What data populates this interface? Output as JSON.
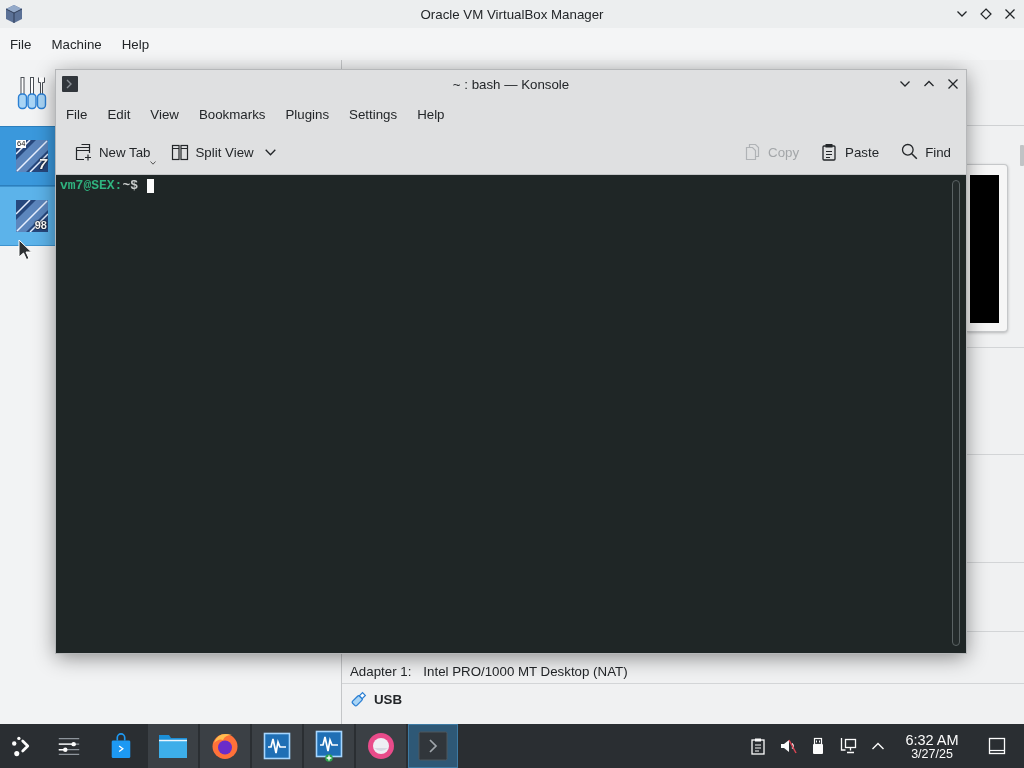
{
  "vbox_window": {
    "title": "Oracle VM VirtualBox Manager",
    "menu": [
      {
        "label": "File"
      },
      {
        "label": "Machine"
      },
      {
        "label": "Help"
      }
    ],
    "machines": [
      {
        "arch_badge": "64",
        "os_badge": "7",
        "selected": true,
        "hovered": false
      },
      {
        "os_badge": "98",
        "selected": false,
        "hovered": true
      }
    ],
    "details": {
      "network_rows": [
        {
          "label": "Adapter 1:",
          "value": "Intel PRO/1000 MT Desktop (NAT)"
        }
      ],
      "usb": {
        "title": "USB"
      }
    }
  },
  "konsole": {
    "title": "~ : bash — Konsole",
    "menu": [
      {
        "label": "File"
      },
      {
        "label": "Edit"
      },
      {
        "label": "View"
      },
      {
        "label": "Bookmarks"
      },
      {
        "label": "Plugins"
      },
      {
        "label": "Settings"
      },
      {
        "label": "Help"
      }
    ],
    "toolbar_left": [
      {
        "kind": "new-tab",
        "label": "New Tab",
        "has_menu": true
      },
      {
        "kind": "split-view",
        "label": "Split View",
        "has_menu": true
      }
    ],
    "toolbar_right": [
      {
        "kind": "copy",
        "label": "Copy",
        "disabled": true
      },
      {
        "kind": "paste",
        "label": "Paste",
        "disabled": false
      },
      {
        "kind": "find",
        "label": "Find",
        "disabled": false
      }
    ],
    "terminal": {
      "prompt": [
        {
          "text": "vm7@SEX:",
          "color": "#2fb37f"
        },
        {
          "text": "~$",
          "color": "#c9cdcc"
        }
      ]
    }
  },
  "taskbar": {
    "tasks": [
      {
        "kind": "launcher",
        "running": false,
        "active": false
      },
      {
        "kind": "settings",
        "running": false,
        "active": false
      },
      {
        "kind": "store",
        "running": false,
        "active": false
      },
      {
        "kind": "files",
        "running": true,
        "active": false
      },
      {
        "kind": "browser",
        "running": true,
        "active": false
      },
      {
        "kind": "vm",
        "running": true,
        "active": false
      },
      {
        "kind": "vm-new",
        "running": true,
        "active": false
      },
      {
        "kind": "round-app",
        "running": true,
        "active": false
      },
      {
        "kind": "terminal",
        "running": true,
        "active": true
      }
    ],
    "clock": {
      "time": "6:32 AM",
      "date": "3/27/25"
    }
  }
}
